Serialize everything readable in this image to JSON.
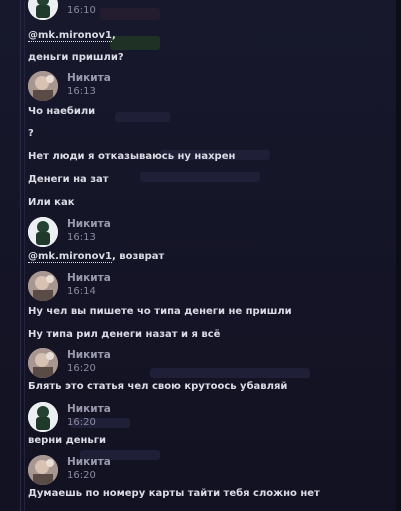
{
  "messages": [
    {
      "type": "header",
      "author": "",
      "time": "16:10",
      "avatar": "dark-avatar"
    },
    {
      "type": "text",
      "mention": "@mk.mironov1",
      "text": ","
    },
    {
      "type": "text",
      "text": "деньги пришли?"
    },
    {
      "type": "header",
      "author": "Никита",
      "time": "16:13",
      "avatar": "photo-avatar"
    },
    {
      "type": "text",
      "text": "Чо наебили"
    },
    {
      "type": "text",
      "text": "?"
    },
    {
      "type": "text",
      "text": "Нет люди я отказываюсь ну нахрен"
    },
    {
      "type": "text",
      "text": "Денеги на зат"
    },
    {
      "type": "text",
      "text": "Или как"
    },
    {
      "type": "header",
      "author": "Никита",
      "time": "16:13",
      "avatar": "dark-avatar"
    },
    {
      "type": "text",
      "mention": "@mk.mironov1",
      "text": ", возврат"
    },
    {
      "type": "header",
      "author": "Никита",
      "time": "16:14",
      "avatar": "photo-avatar"
    },
    {
      "type": "text",
      "text": "Ну чел вы пишете чо типа денеги не пришли"
    },
    {
      "type": "text",
      "text": "Ну типа рил денеги назат и я всё"
    },
    {
      "type": "header",
      "author": "Никита",
      "time": "16:20",
      "avatar": "photo-avatar"
    },
    {
      "type": "text",
      "text": "Блять это статья чел свою крутоось убавляй"
    },
    {
      "type": "header",
      "author": "Никита",
      "time": "16:20",
      "avatar": "dark-avatar"
    },
    {
      "type": "text",
      "text": "верни деньги"
    },
    {
      "type": "header",
      "author": "Никита",
      "time": "16:20",
      "avatar": "photo-avatar"
    },
    {
      "type": "text",
      "text": "Думаешь по номеру карты тайти тебя сложно нет"
    }
  ],
  "colors": {
    "background": "#15152a",
    "text": "#dcdce6",
    "author": "#9a9aae",
    "time": "#8a8aa0"
  }
}
